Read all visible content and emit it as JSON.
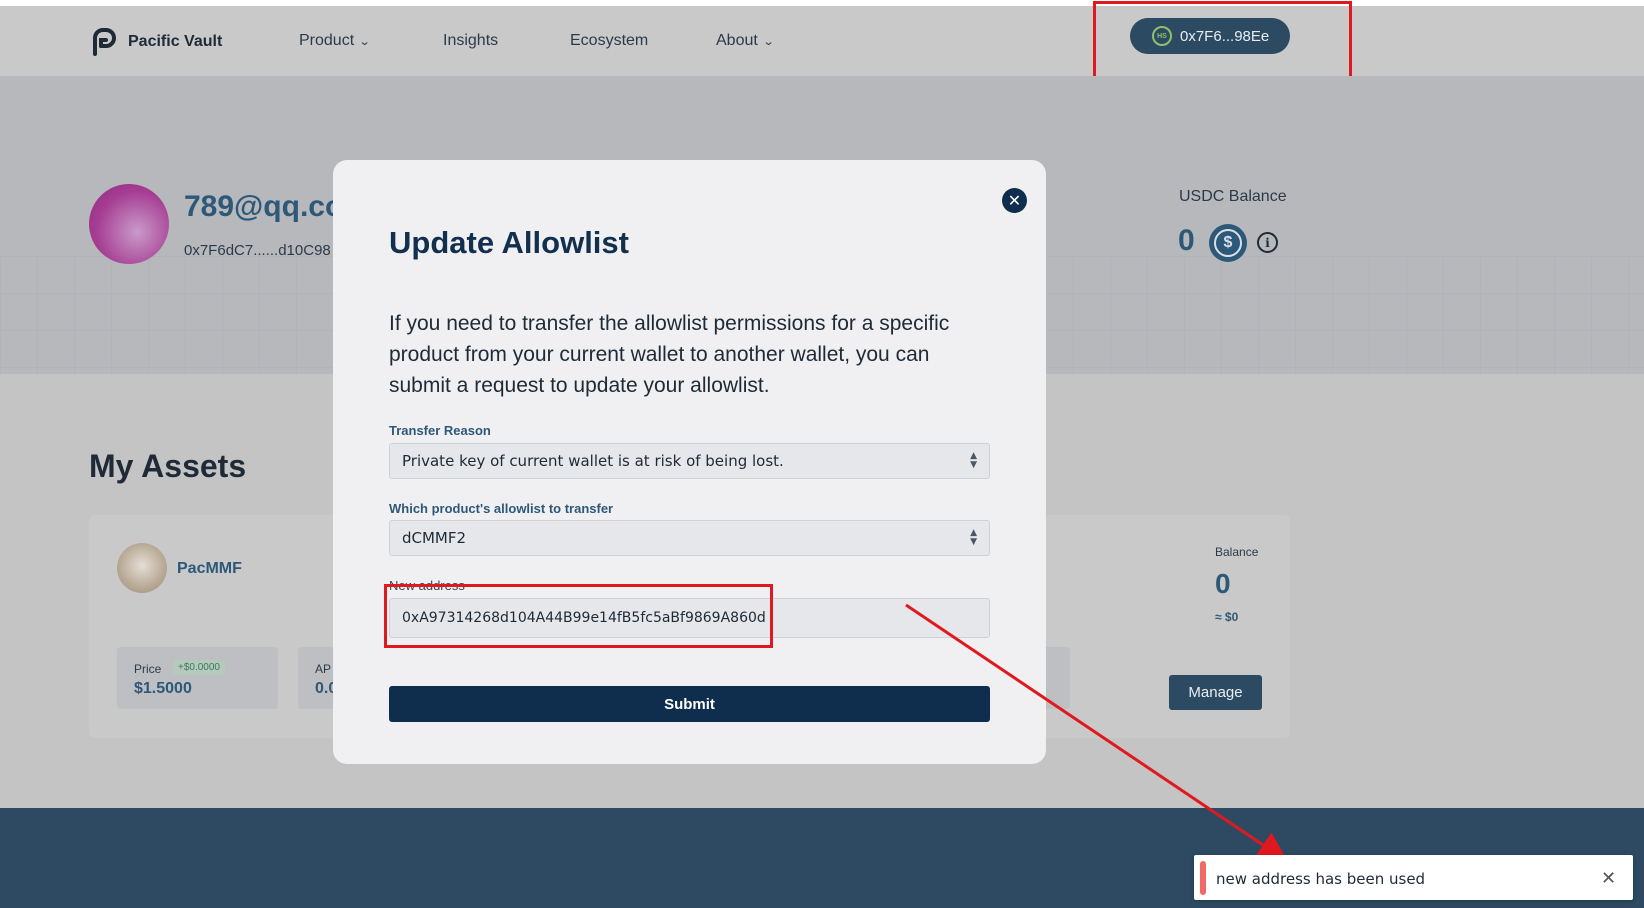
{
  "nav": {
    "brand": "Pacific Vault",
    "items": [
      {
        "label": "Product",
        "has_dropdown": true
      },
      {
        "label": "Insights",
        "has_dropdown": false
      },
      {
        "label": "Ecosystem",
        "has_dropdown": false
      },
      {
        "label": "About",
        "has_dropdown": true
      }
    ],
    "wallet_badge": "HS",
    "wallet_address": "0x7F6...98Ee"
  },
  "profile": {
    "email": "789@qq.co",
    "address": "0x7F6dC7......d10C98"
  },
  "usdc": {
    "label": "USDC Balance",
    "value": "0",
    "coin_icon": "usdc-coin-icon",
    "coin_symbol": "$",
    "info_symbol": "i"
  },
  "assets": {
    "title": "My Assets",
    "items": [
      {
        "name": "PacMMF",
        "price_label": "Price",
        "price_delta": "+$0.0000",
        "price_value": "$1.5000",
        "apy_label": "AP",
        "apy_value": "0.0",
        "balance_label": "Balance",
        "balance_value": "0",
        "balance_usd": "≈ $0",
        "manage_label": "Manage"
      }
    ]
  },
  "modal": {
    "title": "Update Allowlist",
    "description": "If you need to transfer the allowlist permissions for a specific product from your current wallet to another wallet, you can submit a request to update your allowlist.",
    "close_symbol": "✕",
    "transfer_reason_label": "Transfer Reason",
    "transfer_reason_value": "Private key of current wallet is at risk of being lost.",
    "product_label": "Which product's allowlist to transfer",
    "product_value": "dCMMF2",
    "new_address_label": "New address",
    "new_address_value": "0xA97314268d104A44B99e14fB5fc5aBf9869A860d",
    "submit_label": "Submit"
  },
  "toast": {
    "message": "new address has been used",
    "close_symbol": "✕",
    "accent_color": "#f06a6a"
  },
  "colors": {
    "primary_dark": "#0f2d4d",
    "brand_blue": "#2e5878",
    "highlight_red": "#e0191e"
  }
}
